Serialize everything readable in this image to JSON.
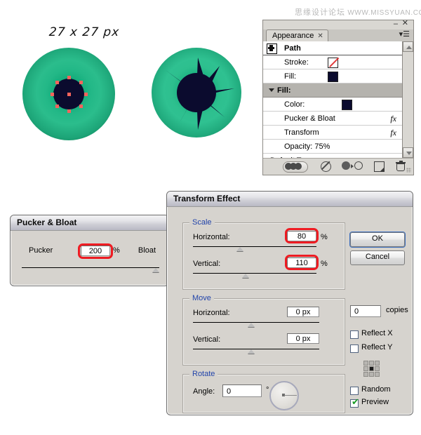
{
  "watermark": {
    "cn": "思缘设计论坛",
    "url": "WWW.MISSYUAN.COM"
  },
  "artwork": {
    "size_label": "27 x 27 px",
    "eye_left_name": "eye-before-effect",
    "eye_right_name": "eye-after-effect",
    "iris_gradient_inner": "#2bbd8c",
    "iris_gradient_outer": "#05603c",
    "pupil_color": "#0b0b2e",
    "anchor_point_color": "#f4645c"
  },
  "appearance_panel": {
    "tab_label": "Appearance",
    "tab_close": "✕",
    "minimize": "–",
    "close": "✕",
    "menu_icon": "▾☰",
    "rows": [
      {
        "label": "Path",
        "type": "header"
      },
      {
        "label": "Stroke:",
        "type": "swatch-none"
      },
      {
        "label": "Fill:",
        "type": "swatch",
        "color": "#0b0b2e"
      },
      {
        "label": "Fill:",
        "type": "group-selected"
      },
      {
        "label": "Color:",
        "type": "swatch",
        "color": "#0b0b2e"
      },
      {
        "label": "Pucker & Bloat",
        "type": "effect",
        "fx": "fx"
      },
      {
        "label": "Transform",
        "type": "effect",
        "fx": "fx"
      },
      {
        "label": "Opacity: 75%",
        "type": "text"
      },
      {
        "label": "Default Transparency",
        "type": "footer-text"
      }
    ],
    "footer_buttons": [
      "new-art-has-basic-appearance",
      "clear-appearance",
      "reduce-to-basic-appearance",
      "duplicate-selected-item",
      "delete-selected-item"
    ]
  },
  "pucker_dialog": {
    "title": "Pucker & Bloat",
    "left_label": "Pucker",
    "right_label": "Bloat",
    "value": "200",
    "percent": "%"
  },
  "transform_dialog": {
    "title": "Transform Effect",
    "scale": {
      "legend": "Scale",
      "horizontal_label": "Horizontal:",
      "horizontal_value": "80",
      "horizontal_unit": "%",
      "vertical_label": "Vertical:",
      "vertical_value": "110",
      "vertical_unit": "%"
    },
    "move": {
      "legend": "Move",
      "horizontal_label": "Horizontal:",
      "horizontal_value": "0 px",
      "vertical_label": "Vertical:",
      "vertical_value": "0 px"
    },
    "rotate": {
      "legend": "Rotate",
      "angle_label": "Angle:",
      "angle_value": "0",
      "degree_sign": "°"
    },
    "buttons": {
      "ok": "OK",
      "cancel": "Cancel"
    },
    "copies": {
      "value": "0",
      "label": "copies"
    },
    "checkboxes": [
      {
        "label": "Reflect X",
        "checked": false
      },
      {
        "label": "Reflect Y",
        "checked": false
      },
      {
        "label": "Random",
        "checked": false
      },
      {
        "label": "Preview",
        "checked": true
      }
    ],
    "check_glyph": "✔",
    "accent_legend_color": "#2244aa",
    "annotation_color": "#ee1b22"
  }
}
